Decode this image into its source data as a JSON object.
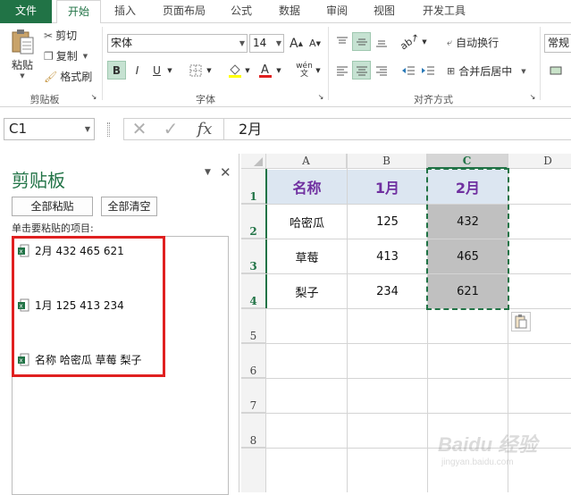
{
  "tabs": [
    {
      "label": "文件"
    },
    {
      "label": "开始"
    },
    {
      "label": "插入"
    },
    {
      "label": "页面布局"
    },
    {
      "label": "公式"
    },
    {
      "label": "数据"
    },
    {
      "label": "审阅"
    },
    {
      "label": "视图"
    },
    {
      "label": "开发工具"
    }
  ],
  "ribbon": {
    "clipboard": {
      "paste": "粘贴",
      "cut": "剪切",
      "copy": "复制",
      "format_painter": "格式刷",
      "group_label": "剪贴板"
    },
    "font": {
      "font_name": "宋体",
      "font_size": "14",
      "bold": "B",
      "italic": "I",
      "underline": "U",
      "grow": "A",
      "shrink": "A",
      "group_label": "字体",
      "phonetic": "wén"
    },
    "alignment": {
      "wrap_text": "自动换行",
      "merge_center": "合并后居中",
      "group_label": "对齐方式"
    },
    "number": {
      "format": "常规"
    }
  },
  "formula_bar": {
    "name_box": "C1",
    "cancel": "✕",
    "enter": "✓",
    "fx": "fx",
    "content": "2月"
  },
  "clipboard_pane": {
    "title": "剪贴板",
    "paste_all": "全部粘贴",
    "clear_all": "全部清空",
    "hint": "单击要粘贴的项目:",
    "items": [
      {
        "text": "2月 432 465 621"
      },
      {
        "text": "1月 125 413 234"
      },
      {
        "text": "名称 哈密瓜 草莓 梨子"
      }
    ]
  },
  "sheet": {
    "columns": [
      "A",
      "B",
      "C",
      "D"
    ],
    "rows": [
      "1",
      "2",
      "3",
      "4",
      "5",
      "6",
      "7",
      "8"
    ],
    "header_row": [
      "名称",
      "1月",
      "2月"
    ],
    "data": [
      [
        "哈密瓜",
        "125",
        "432"
      ],
      [
        "草莓",
        "413",
        "465"
      ],
      [
        "梨子",
        "234",
        "621"
      ]
    ]
  },
  "watermark": {
    "text": "Baidu 经验",
    "sub": "jingyan.baidu.com"
  },
  "colors": {
    "accent": "#217346",
    "header_fill": "#dce6f1",
    "header_text": "#7030a0",
    "selection_fill": "#c0c0c0",
    "highlight": "#e02020"
  }
}
